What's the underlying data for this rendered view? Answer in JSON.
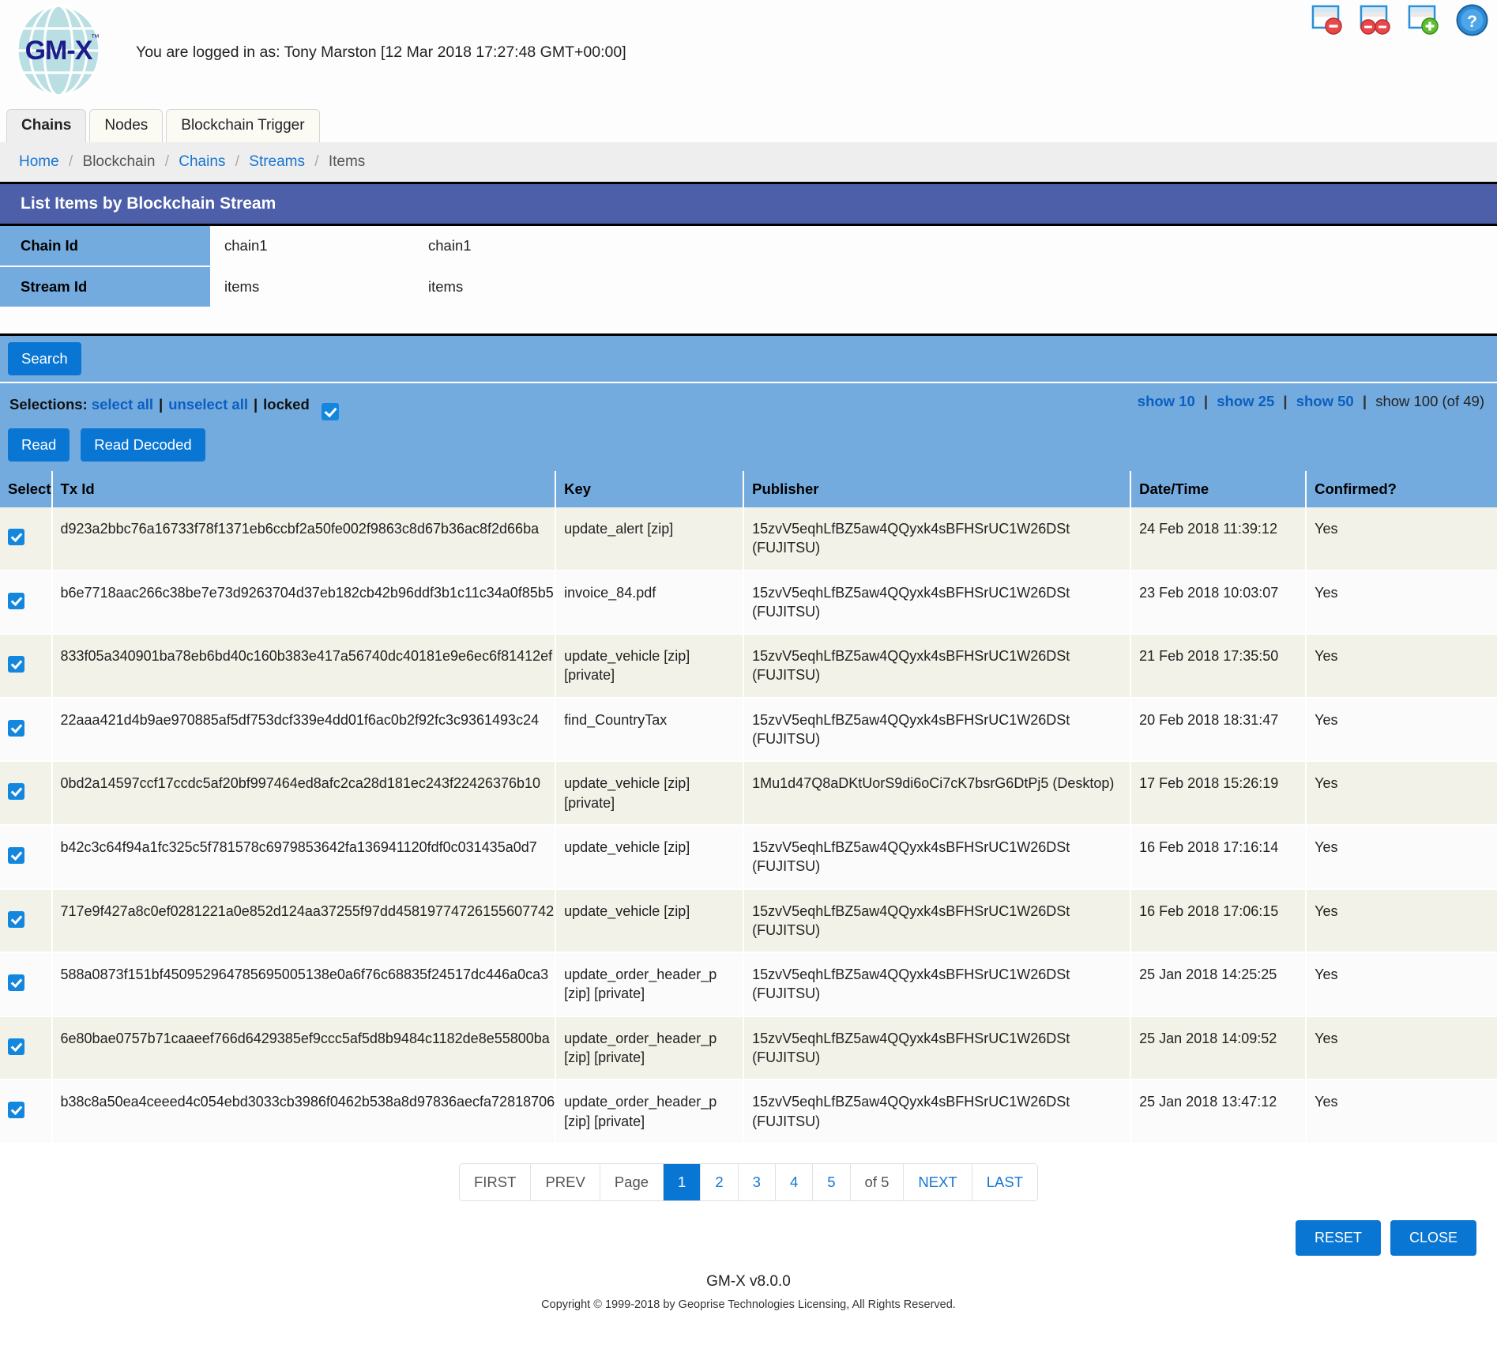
{
  "header": {
    "logo_text": "GM-X",
    "login_status": "You are logged in as: Tony Marston [12 Mar 2018 17:27:48 GMT+00:00]",
    "icons": [
      {
        "name": "close-window-icon",
        "title": "Close Window"
      },
      {
        "name": "close-all-windows-icon",
        "title": "Close All Windows"
      },
      {
        "name": "new-window-icon",
        "title": "New Window"
      },
      {
        "name": "help-icon",
        "title": "Help"
      }
    ]
  },
  "tabs": [
    {
      "label": "Chains",
      "active": true
    },
    {
      "label": "Nodes",
      "active": false
    },
    {
      "label": "Blockchain Trigger",
      "active": false
    }
  ],
  "breadcrumb": {
    "items": [
      "Home",
      "Blockchain",
      "Chains",
      "Streams",
      "Items"
    ],
    "separator": "/"
  },
  "panel": {
    "title": "List Items by Blockchain Stream",
    "fields": [
      {
        "label": "Chain Id",
        "value1": "chain1",
        "value2": "chain1"
      },
      {
        "label": "Stream Id",
        "value1": "items",
        "value2": "items"
      }
    ],
    "search_label": "Search"
  },
  "selections": {
    "prefix": "Selections:",
    "select_all": "select all",
    "unselect_all": "unselect all",
    "locked": "locked",
    "locked_checked": true,
    "pipe": "|",
    "show_links": [
      {
        "label": "show 10",
        "link": true
      },
      {
        "label": "show 25",
        "link": true
      },
      {
        "label": "show 50",
        "link": true
      },
      {
        "label": "show 100 (of 49)",
        "link": false
      }
    ],
    "actions": [
      "Read",
      "Read Decoded"
    ]
  },
  "table": {
    "columns": [
      "Select",
      "Tx Id",
      "Key",
      "Publisher",
      "Date/Time",
      "Confirmed?"
    ],
    "rows": [
      {
        "tx_id": "d923a2bbc76a16733f78f1371eb6ccbf2a50fe002f9863c8d67b36ac8f2d66ba",
        "key": "update_alert [zip]",
        "publisher": "15zvV5eqhLfBZ5aw4QQyxk4sBFHSrUC1W26DSt",
        "publisher_name": "(FUJITSU)",
        "datetime": "24 Feb 2018 11:39:12",
        "confirmed": "Yes",
        "selected": true
      },
      {
        "tx_id": "b6e7718aac266c38be7e73d9263704d37eb182cb42b96ddf3b1c11c34a0f85b5",
        "key": "invoice_84.pdf",
        "publisher": "15zvV5eqhLfBZ5aw4QQyxk4sBFHSrUC1W26DSt",
        "publisher_name": "(FUJITSU)",
        "datetime": "23 Feb 2018 10:03:07",
        "confirmed": "Yes",
        "selected": true
      },
      {
        "tx_id": "833f05a340901ba78eb6bd40c160b383e417a56740dc40181e9e6ec6f81412ef",
        "key": "update_vehicle [zip] [private]",
        "publisher": "15zvV5eqhLfBZ5aw4QQyxk4sBFHSrUC1W26DSt",
        "publisher_name": "(FUJITSU)",
        "datetime": "21 Feb 2018 17:35:50",
        "confirmed": "Yes",
        "selected": true
      },
      {
        "tx_id": "22aaa421d4b9ae970885af5df753dcf339e4dd01f6ac0b2f92fc3c9361493c24",
        "key": "find_CountryTax",
        "publisher": "15zvV5eqhLfBZ5aw4QQyxk4sBFHSrUC1W26DSt",
        "publisher_name": "(FUJITSU)",
        "datetime": "20 Feb 2018 18:31:47",
        "confirmed": "Yes",
        "selected": true
      },
      {
        "tx_id": "0bd2a14597ccf17ccdc5af20bf997464ed8afc2ca28d181ec243f22426376b10",
        "key": "update_vehicle [zip] [private]",
        "publisher": "1Mu1d47Q8aDKtUorS9di6oCi7cK7bsrG6DtPj5",
        "publisher_name": "(Desktop)",
        "datetime": "17 Feb 2018 15:26:19",
        "confirmed": "Yes",
        "selected": true
      },
      {
        "tx_id": "b42c3c64f94a1fc325c5f781578c6979853642fa136941120fdf0c031435a0d7",
        "key": "update_vehicle [zip]",
        "publisher": "15zvV5eqhLfBZ5aw4QQyxk4sBFHSrUC1W26DSt",
        "publisher_name": "(FUJITSU)",
        "datetime": "16 Feb 2018 17:16:14",
        "confirmed": "Yes",
        "selected": true
      },
      {
        "tx_id": "717e9f427a8c0ef0281221a0e852d124aa37255f97dd45819774726155607742",
        "key": "update_vehicle [zip]",
        "publisher": "15zvV5eqhLfBZ5aw4QQyxk4sBFHSrUC1W26DSt",
        "publisher_name": "(FUJITSU)",
        "datetime": "16 Feb 2018 17:06:15",
        "confirmed": "Yes",
        "selected": true
      },
      {
        "tx_id": "588a0873f151bf450952964785695005138e0a6f76c68835f24517dc446a0ca3",
        "key": "update_order_header_p [zip] [private]",
        "publisher": "15zvV5eqhLfBZ5aw4QQyxk4sBFHSrUC1W26DSt",
        "publisher_name": "(FUJITSU)",
        "datetime": "25 Jan 2018 14:25:25",
        "confirmed": "Yes",
        "selected": true
      },
      {
        "tx_id": "6e80bae0757b71caaeef766d6429385ef9ccc5af5d8b9484c1182de8e55800ba",
        "key": "update_order_header_p [zip] [private]",
        "publisher": "15zvV5eqhLfBZ5aw4QQyxk4sBFHSrUC1W26DSt",
        "publisher_name": "(FUJITSU)",
        "datetime": "25 Jan 2018 14:09:52",
        "confirmed": "Yes",
        "selected": true
      },
      {
        "tx_id": "b38c8a50ea4ceeed4c054ebd3033cb3986f0462b538a8d97836aecfa72818706",
        "key": "update_order_header_p [zip] [private]",
        "publisher": "15zvV5eqhLfBZ5aw4QQyxk4sBFHSrUC1W26DSt",
        "publisher_name": "(FUJITSU)",
        "datetime": "25 Jan 2018 13:47:12",
        "confirmed": "Yes",
        "selected": true
      }
    ]
  },
  "pagination": {
    "first": "FIRST",
    "prev": "PREV",
    "page_label": "Page",
    "pages": [
      "1",
      "2",
      "3",
      "4",
      "5"
    ],
    "current_page": "1",
    "of_label": "of 5",
    "next": "NEXT",
    "last": "LAST"
  },
  "footer_buttons": [
    {
      "label": "RESET",
      "name": "reset-button"
    },
    {
      "label": "CLOSE",
      "name": "close-button"
    }
  ],
  "footer": {
    "version": "GM-X v8.0.0",
    "copyright": "Copyright © 1999-2018 by Geoprise Technologies Licensing, All Rights Reserved."
  },
  "colors": {
    "panel_title_bg": "#4c5fa8",
    "band_blue": "#74abdf",
    "accent_blue": "#0a76d4",
    "link_blue": "#1676d2",
    "row_odd": "#f2f2e8",
    "row_even": "#fbfbfb"
  }
}
